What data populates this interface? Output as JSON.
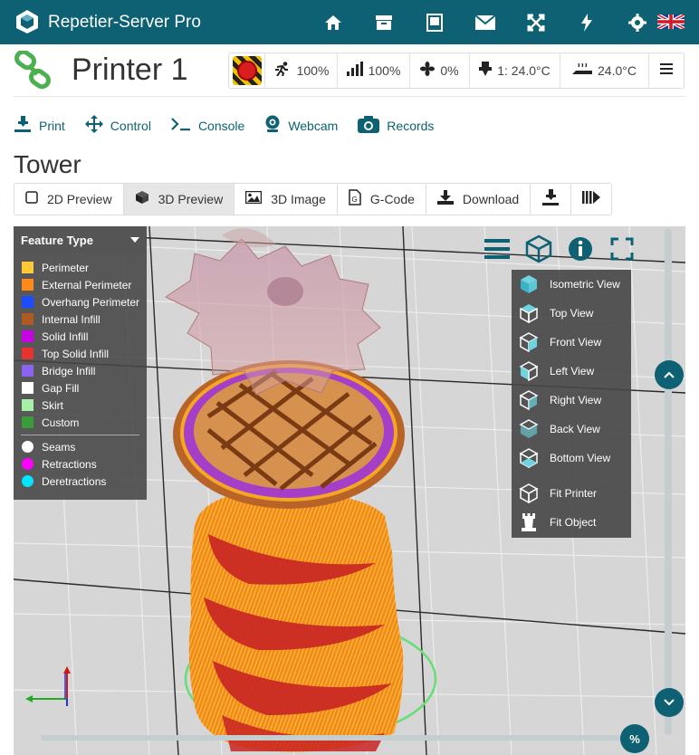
{
  "app": {
    "title": "Repetier-Server Pro"
  },
  "topnav": {
    "icons": [
      "home-icon",
      "archive-icon",
      "book-icon",
      "mail-icon",
      "fullscreen-icon",
      "flash-icon",
      "gear-icon"
    ],
    "language": "en-GB"
  },
  "printer": {
    "name": "Printer 1",
    "speed": "100%",
    "flow": "100%",
    "fan": "0%",
    "extruder": "1: 24.0°C",
    "bed": "24.0°C"
  },
  "nav": {
    "print": "Print",
    "control": "Control",
    "console": "Console",
    "webcam": "Webcam",
    "records": "Records"
  },
  "page": {
    "title": "Tower"
  },
  "tabs": {
    "preview2d": "2D Preview",
    "preview3d": "3D Preview",
    "image3d": "3D Image",
    "gcode": "G-Code",
    "download": "Download"
  },
  "legend": {
    "title": "Feature Type",
    "features": [
      {
        "label": "Perimeter",
        "color": "#ffc835"
      },
      {
        "label": "External Perimeter",
        "color": "#ff8a1a"
      },
      {
        "label": "Overhang Perimeter",
        "color": "#1a4dff"
      },
      {
        "label": "Internal Infill",
        "color": "#b05a23"
      },
      {
        "label": "Solid Infill",
        "color": "#c800e6"
      },
      {
        "label": "Top Solid Infill",
        "color": "#e8322e"
      },
      {
        "label": "Bridge Infill",
        "color": "#8a63f2"
      },
      {
        "label": "Gap Fill",
        "color": "#ffffff"
      },
      {
        "label": "Skirt",
        "color": "#a8f0a8"
      },
      {
        "label": "Custom",
        "color": "#3a9c3a"
      }
    ],
    "markers": [
      {
        "label": "Seams",
        "color": "#ffffff"
      },
      {
        "label": "Retractions",
        "color": "#ff00ff"
      },
      {
        "label": "Deretractions",
        "color": "#00e5ff"
      }
    ]
  },
  "view_menu": {
    "items": [
      "Isometric View",
      "Top View",
      "Front View",
      "Left View",
      "Right View",
      "Back View",
      "Bottom View"
    ],
    "fit_printer": "Fit Printer",
    "fit_object": "Fit Object"
  },
  "zoom_button": "%"
}
